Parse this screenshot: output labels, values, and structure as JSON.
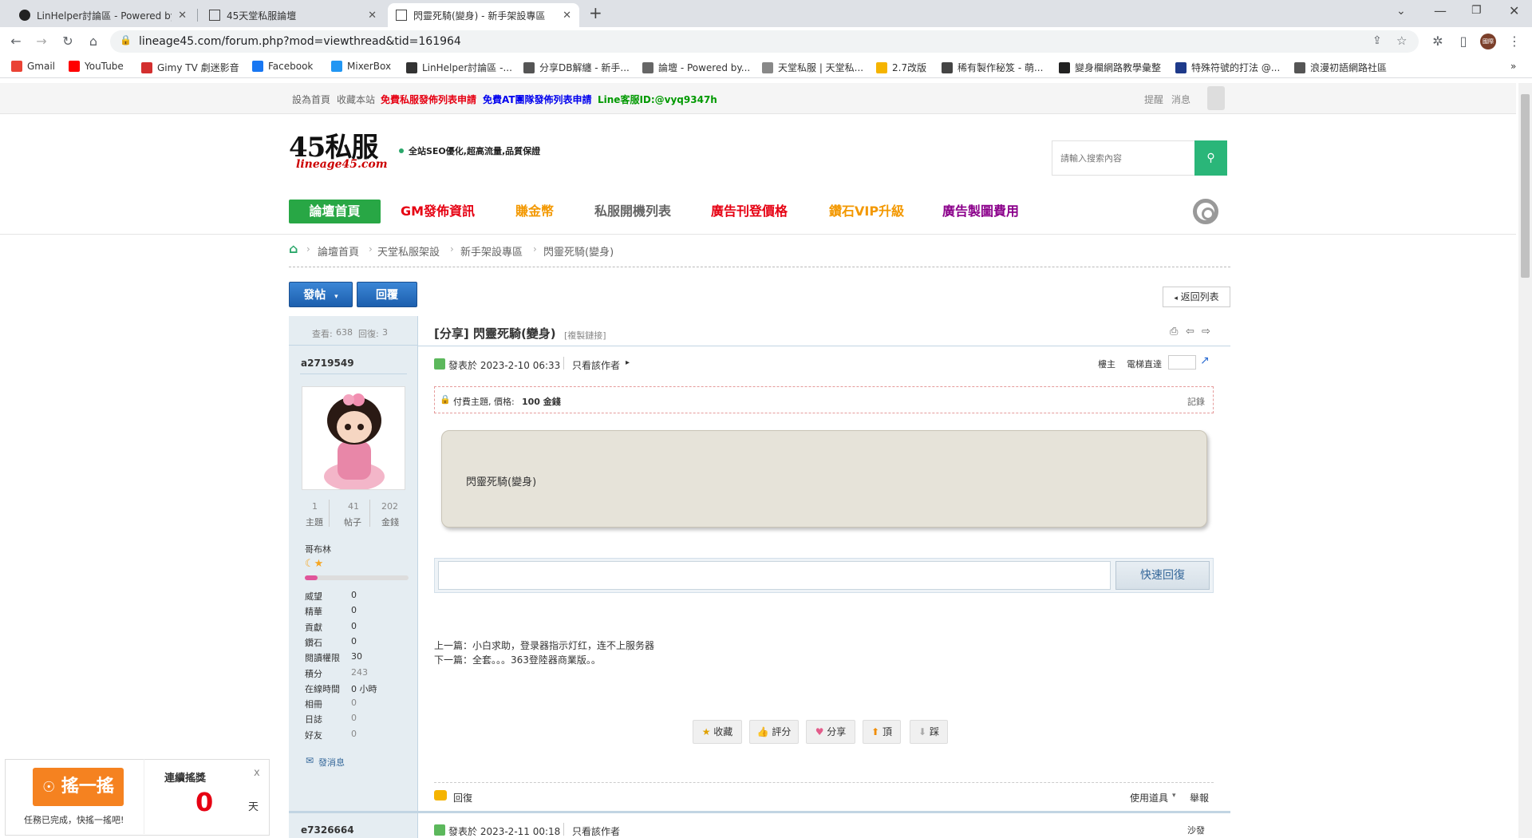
{
  "browser": {
    "tabs": [
      {
        "title": "LinHelper討論區 - Powered by D",
        "active": false
      },
      {
        "title": "45天堂私服論壇",
        "active": false
      },
      {
        "title": "閃靈死騎(變身) - 新手架設專區",
        "active": true
      }
    ],
    "new_tab": "+",
    "url": "lineage45.com/forum.php?mod=viewthread&tid=161964",
    "profile_label": "國際"
  },
  "bookmarks": [
    {
      "label": "Gmail",
      "color": "#ea4335"
    },
    {
      "label": "YouTube",
      "color": "#ff0000"
    },
    {
      "label": "Gimy TV 劇迷影音",
      "color": "#d32f2f"
    },
    {
      "label": "Facebook",
      "color": "#1877f2"
    },
    {
      "label": "MixerBox",
      "color": "#2196f3"
    },
    {
      "label": "LinHelper討論區 -...",
      "color": "#333333"
    },
    {
      "label": "分享DB解纏 - 新手...",
      "color": "#555555"
    },
    {
      "label": "論壇 - Powered by...",
      "color": "#666666"
    },
    {
      "label": "天堂私服 | 天堂私...",
      "color": "#888888"
    },
    {
      "label": "2.7改版",
      "color": "#f5b400"
    },
    {
      "label": "稀有製作秘笈 - 萌...",
      "color": "#444444"
    },
    {
      "label": "變身欄網路教學彙整",
      "color": "#222222"
    },
    {
      "label": "特殊符號的打法 @...",
      "color": "#1e3a8a"
    },
    {
      "label": "浪漫初語網路社區",
      "color": "#555555"
    }
  ],
  "topnav": {
    "set_home": "設為首頁",
    "bookmark": "收藏本站",
    "free_private": "免費私服發佈列表申請",
    "free_at": "免費AT團隊發佈列表申請",
    "line": "Line客服ID:@vyq9347h",
    "remind": "提醒",
    "message": "消息"
  },
  "header": {
    "logo": "45私服",
    "logo_sub": "lineage45.com",
    "slogan": "全站SEO優化,超高流量,品質保證",
    "search_placeholder": "請輸入搜索內容"
  },
  "nav": [
    {
      "label": "論壇首頁",
      "color": "#ffffff"
    },
    {
      "label": "GM發佈資訊",
      "color": "#e60012"
    },
    {
      "label": "賺金幣",
      "color": "#f39800"
    },
    {
      "label": "私服開機列表",
      "color": "#666666"
    },
    {
      "label": "廣告刊登價格",
      "color": "#e60012"
    },
    {
      "label": "鑽石VIP升級",
      "color": "#f39800"
    },
    {
      "label": "廣告製圖費用",
      "color": "#8b008b"
    }
  ],
  "breadcrumb": [
    "論壇首頁",
    "天堂私服架設",
    "新手架設專區",
    "閃靈死騎(變身)"
  ],
  "actions": {
    "post": "發帖",
    "reply": "回覆",
    "back_list": "返回列表"
  },
  "thread": {
    "views_label": "查看:",
    "views": "638",
    "replies_label": "回復:",
    "replies": "3",
    "prefix": "[分享]",
    "title": "閃靈死騎(變身)",
    "copy_link": "[複製鏈接]"
  },
  "author": {
    "name": "a2719549",
    "stats": [
      {
        "value": "1",
        "label": "主題"
      },
      {
        "value": "41",
        "label": "帖子"
      },
      {
        "value": "202",
        "label": "金錢"
      }
    ],
    "rank": "哥布林",
    "fields": [
      {
        "label": "威望",
        "value": "0"
      },
      {
        "label": "精華",
        "value": "0"
      },
      {
        "label": "貢獻",
        "value": "0"
      },
      {
        "label": "鑽石",
        "value": "0"
      },
      {
        "label": "閱讀權限",
        "value": "30"
      },
      {
        "label": "積分",
        "value": "243"
      },
      {
        "label": "在線時間",
        "value": "0 小時"
      },
      {
        "label": "相冊",
        "value": "0"
      },
      {
        "label": "日誌",
        "value": "0"
      },
      {
        "label": "好友",
        "value": "0"
      }
    ],
    "send_msg": "發消息"
  },
  "post": {
    "posted": "發表於 2023-2-10 06:33",
    "only_author": "只看該作者",
    "floor": "樓主",
    "elevator": "電梯直達",
    "paid_label": "付費主題, 價格:",
    "paid_value": "100 金錢",
    "record": "記錄",
    "content": "閃靈死騎(變身)",
    "quick_reply": "快速回復",
    "prev": "上一篇：小白求助，登录器指示灯红，连不上服务器",
    "next": "下一篇：全套。。。363登陸器商業版。。",
    "buttons": [
      "收藏",
      "評分",
      "分享",
      "頂",
      "踩"
    ],
    "reply_link": "回復",
    "tools": "使用道具",
    "report": "舉報"
  },
  "post2": {
    "author": "e7326664",
    "posted": "發表於 2023-2-11 00:18",
    "only_author": "只看該作者",
    "floor": "沙發"
  },
  "shake": {
    "button": "搖一搖",
    "status": "任務已完成，快搖一搖吧!",
    "streak_label": "連續搖獎",
    "streak_value": "0",
    "unit": "天",
    "close": "x"
  }
}
